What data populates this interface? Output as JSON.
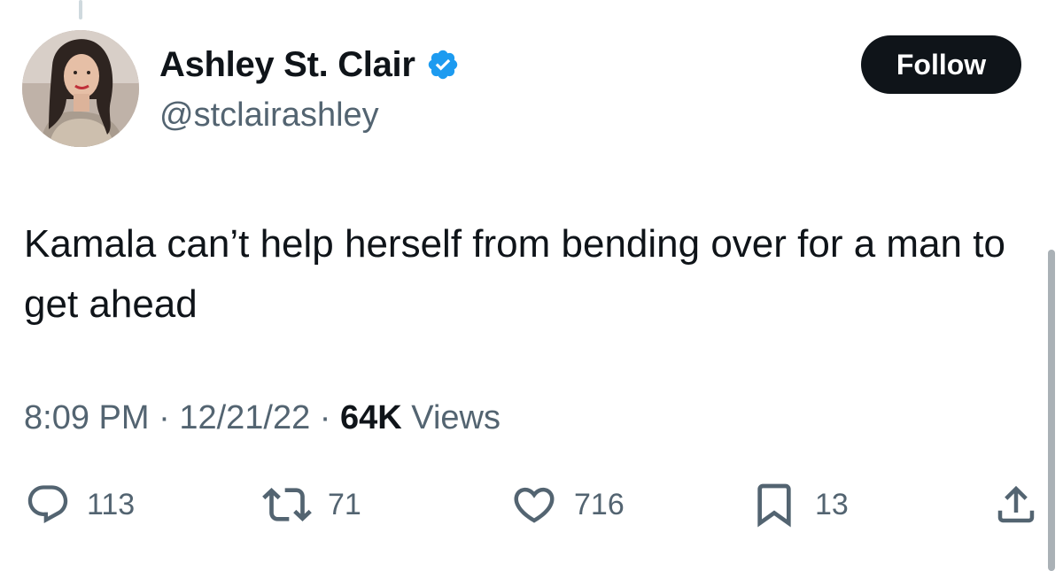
{
  "author": {
    "display_name": "Ashley St. Clair",
    "handle": "@stclairashley",
    "verified_badge_color": "#1d9bf0"
  },
  "follow_button": {
    "label": "Follow"
  },
  "tweet": {
    "text": "Kamala can’t help herself from bending over for a man to get ahead"
  },
  "meta": {
    "time": "8:09 PM",
    "separator": "·",
    "date": "12/21/22",
    "views_count": "64K",
    "views_label": "Views"
  },
  "actions": {
    "replies": {
      "icon": "reply-icon",
      "count": "113"
    },
    "retweets": {
      "icon": "retweet-icon",
      "count": "71"
    },
    "likes": {
      "icon": "heart-icon",
      "count": "716"
    },
    "bookmarks": {
      "icon": "bookmark-icon",
      "count": "13"
    },
    "share": {
      "icon": "share-icon"
    }
  },
  "colors": {
    "text_primary": "#0f1419",
    "text_secondary": "#536471",
    "accent": "#1d9bf0",
    "button_bg": "#0f1419"
  }
}
